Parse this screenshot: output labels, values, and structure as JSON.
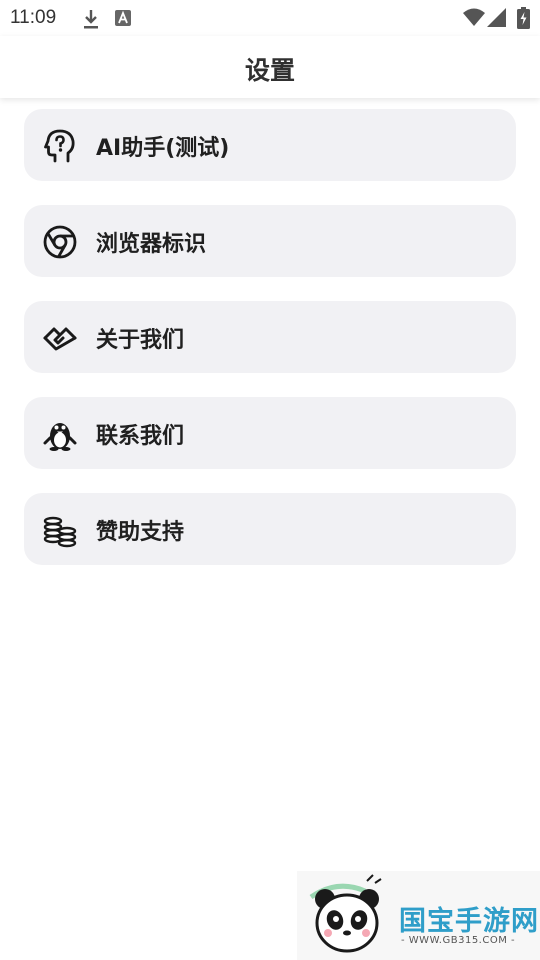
{
  "status_bar": {
    "time": "11:09",
    "icons": [
      "download-icon",
      "a-notification-icon",
      "wifi-icon",
      "signal-icon",
      "battery-charging-icon"
    ]
  },
  "app_bar": {
    "title": "设置"
  },
  "menu": {
    "items": [
      {
        "label": "AI助手(测试)",
        "icon": "ai-head-icon"
      },
      {
        "label": "浏览器标识",
        "icon": "browser-icon"
      },
      {
        "label": "关于我们",
        "icon": "handshake-icon"
      },
      {
        "label": "联系我们",
        "icon": "qq-penguin-icon"
      },
      {
        "label": "赞助支持",
        "icon": "coins-icon"
      }
    ]
  },
  "watermark": {
    "brand": "国宝手游网",
    "url": "- WWW.GB315.COM -",
    "icon": "panda-logo-icon"
  },
  "colors": {
    "card_background": "#f1f1f4",
    "watermark_blue": "#2f9ec9"
  }
}
